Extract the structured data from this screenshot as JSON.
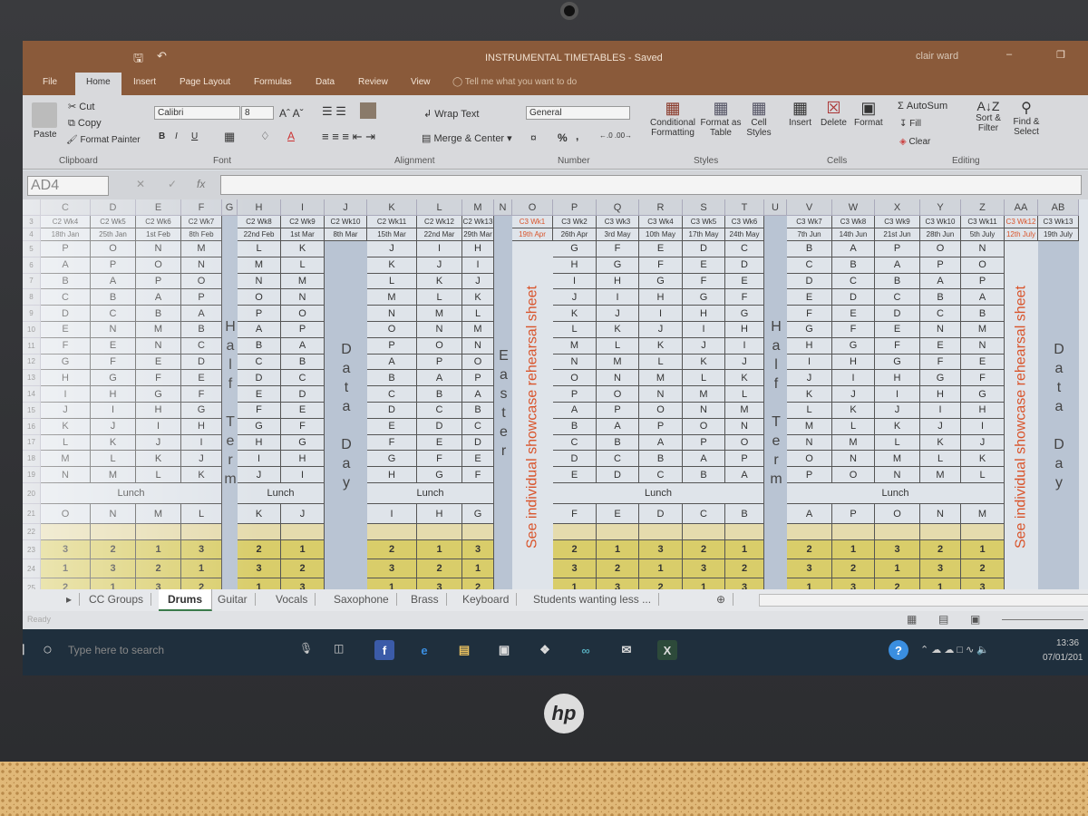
{
  "window": {
    "title": "INSTRUMENTAL TIMETABLES  -  Saved",
    "user": "clair ward"
  },
  "menu": [
    "File",
    "Home",
    "Insert",
    "Page Layout",
    "Formulas",
    "Data",
    "Review",
    "View"
  ],
  "tell_me": "Tell me what you want to do",
  "ribbon": {
    "clipboard": {
      "paste": "Paste",
      "cut": "Cut",
      "copy": "Copy",
      "format_painter": "Format Painter",
      "group": "Clipboard"
    },
    "font": {
      "name": "Calibri",
      "size": "8",
      "group": "Font",
      "bold": "B",
      "italic": "I",
      "underline": "U"
    },
    "alignment": {
      "wrap": "Wrap Text",
      "merge": "Merge & Center",
      "group": "Alignment"
    },
    "number": {
      "format": "General",
      "percent": "%",
      "comma": ",",
      "group": "Number"
    },
    "styles": {
      "conditional": "Conditional Formatting",
      "format_table": "Format as Table",
      "cell_styles": "Cell Styles",
      "group": "Styles"
    },
    "cells": {
      "insert": "Insert",
      "delete": "Delete",
      "format": "Format",
      "group": "Cells"
    },
    "editing": {
      "autosum": "AutoSum",
      "fill": "Fill",
      "clear": "Clear",
      "sort": "Sort & Filter",
      "find": "Find & Select",
      "group": "Editing"
    }
  },
  "formula_bar": {
    "name_box": "AD4",
    "value": ""
  },
  "grid": {
    "row_numbers": [
      3,
      4,
      5,
      6,
      7,
      8,
      9,
      10,
      11,
      12,
      13,
      14,
      15,
      16,
      17,
      18,
      19,
      20,
      21,
      22,
      23,
      24,
      25
    ],
    "lunch_label": "Lunch",
    "groups": [
      {
        "kind": "weeks",
        "cols": [
          {
            "letter": "C",
            "week": "C2 Wk4",
            "date": "18th Jan",
            "cells": [
              "P",
              "A",
              "B",
              "C",
              "D",
              "E",
              "F",
              "G",
              "H",
              "I",
              "J",
              "K",
              "L",
              "M",
              "N"
            ],
            "r21": "O",
            "nums": [
              "3",
              "1",
              "2"
            ]
          },
          {
            "letter": "D",
            "week": "C2 Wk5",
            "date": "25th Jan",
            "cells": [
              "O",
              "P",
              "A",
              "B",
              "C",
              "N",
              "E",
              "F",
              "G",
              "H",
              "I",
              "J",
              "K",
              "L",
              "M"
            ],
            "r21": "N",
            "nums": [
              "2",
              "3",
              "1"
            ]
          },
          {
            "letter": "E",
            "week": "C2 Wk6",
            "date": "1st Feb",
            "cells": [
              "N",
              "O",
              "P",
              "A",
              "B",
              "M",
              "N",
              "E",
              "F",
              "G",
              "H",
              "I",
              "J",
              "K",
              "L"
            ],
            "r21": "M",
            "nums": [
              "1",
              "2",
              "3"
            ]
          },
          {
            "letter": "F",
            "week": "C2 Wk7",
            "date": "8th Feb",
            "cells": [
              "M",
              "N",
              "O",
              "P",
              "A",
              "B",
              "C",
              "D",
              "E",
              "F",
              "G",
              "H",
              "I",
              "J",
              "K"
            ],
            "r21": "L",
            "nums": [
              "3",
              "1",
              "2"
            ]
          }
        ]
      },
      {
        "kind": "break",
        "letter": "G",
        "label": "Half Term"
      },
      {
        "kind": "weeks",
        "cols": [
          {
            "letter": "H",
            "week": "C2 Wk8",
            "date": "22nd Feb",
            "cells": [
              "L",
              "M",
              "N",
              "O",
              "P",
              "A",
              "B",
              "C",
              "D",
              "E",
              "F",
              "G",
              "H",
              "I",
              "J"
            ],
            "r21": "K",
            "nums": [
              "2",
              "3",
              "1"
            ]
          },
          {
            "letter": "I",
            "week": "C2 Wk9",
            "date": "1st Mar",
            "cells": [
              "K",
              "L",
              "M",
              "N",
              "O",
              "P",
              "A",
              "B",
              "C",
              "D",
              "E",
              "F",
              "G",
              "H",
              "I"
            ],
            "r21": "J",
            "nums": [
              "1",
              "2",
              "3"
            ]
          }
        ]
      },
      {
        "kind": "break",
        "letter": "J",
        "week": "C2 Wk10",
        "date": "8th Mar",
        "label": "Data Day"
      },
      {
        "kind": "weeks",
        "cols": [
          {
            "letter": "K",
            "week": "C2 Wk11",
            "date": "15th Mar",
            "cells": [
              "J",
              "K",
              "L",
              "M",
              "N",
              "O",
              "P",
              "A",
              "B",
              "C",
              "D",
              "E",
              "F",
              "G",
              "H"
            ],
            "r21": "I",
            "nums": [
              "2",
              "3",
              "1"
            ]
          },
          {
            "letter": "L",
            "week": "C2 Wk12",
            "date": "22nd Mar",
            "cells": [
              "I",
              "J",
              "K",
              "L",
              "M",
              "N",
              "O",
              "P",
              "A",
              "B",
              "C",
              "D",
              "E",
              "F",
              "G"
            ],
            "r21": "H",
            "nums": [
              "1",
              "2",
              "3"
            ]
          },
          {
            "letter": "M",
            "week": "C2 Wk13",
            "date": "29th Mar",
            "cells": [
              "H",
              "I",
              "J",
              "K",
              "L",
              "M",
              "N",
              "O",
              "P",
              "A",
              "B",
              "C",
              "D",
              "E",
              "F"
            ],
            "r21": "G",
            "nums": [
              "3",
              "1",
              "2"
            ]
          }
        ]
      },
      {
        "kind": "break",
        "letter": "N",
        "label": "Easter"
      },
      {
        "kind": "showcase",
        "letter": "O",
        "week": "C3 Wk1",
        "date": "19th Apr",
        "label": "See individual showcase rehearsal sheet"
      },
      {
        "kind": "weeks",
        "cols": [
          {
            "letter": "P",
            "week": "C3 Wk2",
            "date": "26th Apr",
            "cells": [
              "G",
              "H",
              "I",
              "J",
              "K",
              "L",
              "M",
              "N",
              "O",
              "P",
              "A",
              "B",
              "C",
              "D",
              "E"
            ],
            "r21": "F",
            "nums": [
              "2",
              "3",
              "1"
            ]
          },
          {
            "letter": "Q",
            "week": "C3 Wk3",
            "date": "3rd May",
            "cells": [
              "F",
              "G",
              "H",
              "I",
              "J",
              "K",
              "L",
              "M",
              "N",
              "O",
              "P",
              "A",
              "B",
              "C",
              "D"
            ],
            "r21": "E",
            "nums": [
              "1",
              "2",
              "3"
            ]
          },
          {
            "letter": "R",
            "week": "C3 Wk4",
            "date": "10th May",
            "cells": [
              "E",
              "F",
              "G",
              "H",
              "I",
              "J",
              "K",
              "L",
              "M",
              "N",
              "O",
              "P",
              "A",
              "B",
              "C"
            ],
            "r21": "D",
            "nums": [
              "3",
              "1",
              "2"
            ]
          },
          {
            "letter": "S",
            "week": "C3 Wk5",
            "date": "17th May",
            "cells": [
              "D",
              "E",
              "F",
              "G",
              "H",
              "I",
              "J",
              "K",
              "L",
              "M",
              "N",
              "O",
              "P",
              "A",
              "B"
            ],
            "r21": "C",
            "nums": [
              "2",
              "3",
              "1"
            ]
          },
          {
            "letter": "T",
            "week": "C3 Wk6",
            "date": "24th May",
            "cells": [
              "C",
              "D",
              "E",
              "F",
              "G",
              "H",
              "I",
              "J",
              "K",
              "L",
              "M",
              "N",
              "O",
              "P",
              "A"
            ],
            "r21": "B",
            "nums": [
              "1",
              "2",
              "3"
            ]
          }
        ]
      },
      {
        "kind": "break",
        "letter": "U",
        "label": "Half Term"
      },
      {
        "kind": "weeks",
        "cols": [
          {
            "letter": "V",
            "week": "C3 Wk7",
            "date": "7th Jun",
            "cells": [
              "B",
              "C",
              "D",
              "E",
              "F",
              "G",
              "H",
              "I",
              "J",
              "K",
              "L",
              "M",
              "N",
              "O",
              "P"
            ],
            "r21": "A",
            "nums": [
              "2",
              "3",
              "1"
            ]
          },
          {
            "letter": "W",
            "week": "C3 Wk8",
            "date": "14th Jun",
            "cells": [
              "A",
              "B",
              "C",
              "D",
              "E",
              "F",
              "G",
              "H",
              "I",
              "J",
              "K",
              "L",
              "M",
              "N",
              "O"
            ],
            "r21": "P",
            "nums": [
              "1",
              "2",
              "3"
            ]
          },
          {
            "letter": "X",
            "week": "C3 Wk9",
            "date": "21st Jun",
            "cells": [
              "P",
              "A",
              "B",
              "C",
              "D",
              "E",
              "F",
              "G",
              "H",
              "I",
              "J",
              "K",
              "L",
              "M",
              "N"
            ],
            "r21": "O",
            "nums": [
              "3",
              "1",
              "2"
            ]
          },
          {
            "letter": "Y",
            "week": "C3 Wk10",
            "date": "28th Jun",
            "cells": [
              "O",
              "P",
              "A",
              "B",
              "C",
              "N",
              "E",
              "F",
              "G",
              "H",
              "I",
              "J",
              "K",
              "L",
              "M"
            ],
            "r21": "N",
            "nums": [
              "2",
              "3",
              "1"
            ]
          },
          {
            "letter": "Z",
            "week": "C3 Wk11",
            "date": "5th July",
            "cells": [
              "N",
              "O",
              "P",
              "A",
              "B",
              "M",
              "N",
              "E",
              "F",
              "G",
              "H",
              "I",
              "J",
              "K",
              "L"
            ],
            "r21": "M",
            "nums": [
              "1",
              "2",
              "3"
            ]
          }
        ]
      },
      {
        "kind": "showcase",
        "letter": "AA",
        "week": "C3 Wk12",
        "date": "12th July",
        "label": "See individual showcase rehearsal sheet"
      },
      {
        "kind": "break",
        "letter": "AB",
        "week": "C3 Wk13",
        "date": "19th July",
        "label": "Data Day"
      }
    ]
  },
  "sheet_tabs": [
    "CC Groups",
    "Drums",
    "Guitar",
    "Vocals",
    "Saxophone",
    "Brass",
    "Keyboard",
    "Students wanting less ..."
  ],
  "active_sheet": "Drums",
  "status": "Ready",
  "taskbar": {
    "search_placeholder": "Type here to search",
    "time": "13:36",
    "date": "07/01/201"
  },
  "laptop_brand": "hp",
  "colors": {
    "title_bar": "#8a5a3a",
    "highlight_red": "#d9542b",
    "schedule_yellow": "#d9cd6a",
    "break_column": "#b9c4d3"
  }
}
